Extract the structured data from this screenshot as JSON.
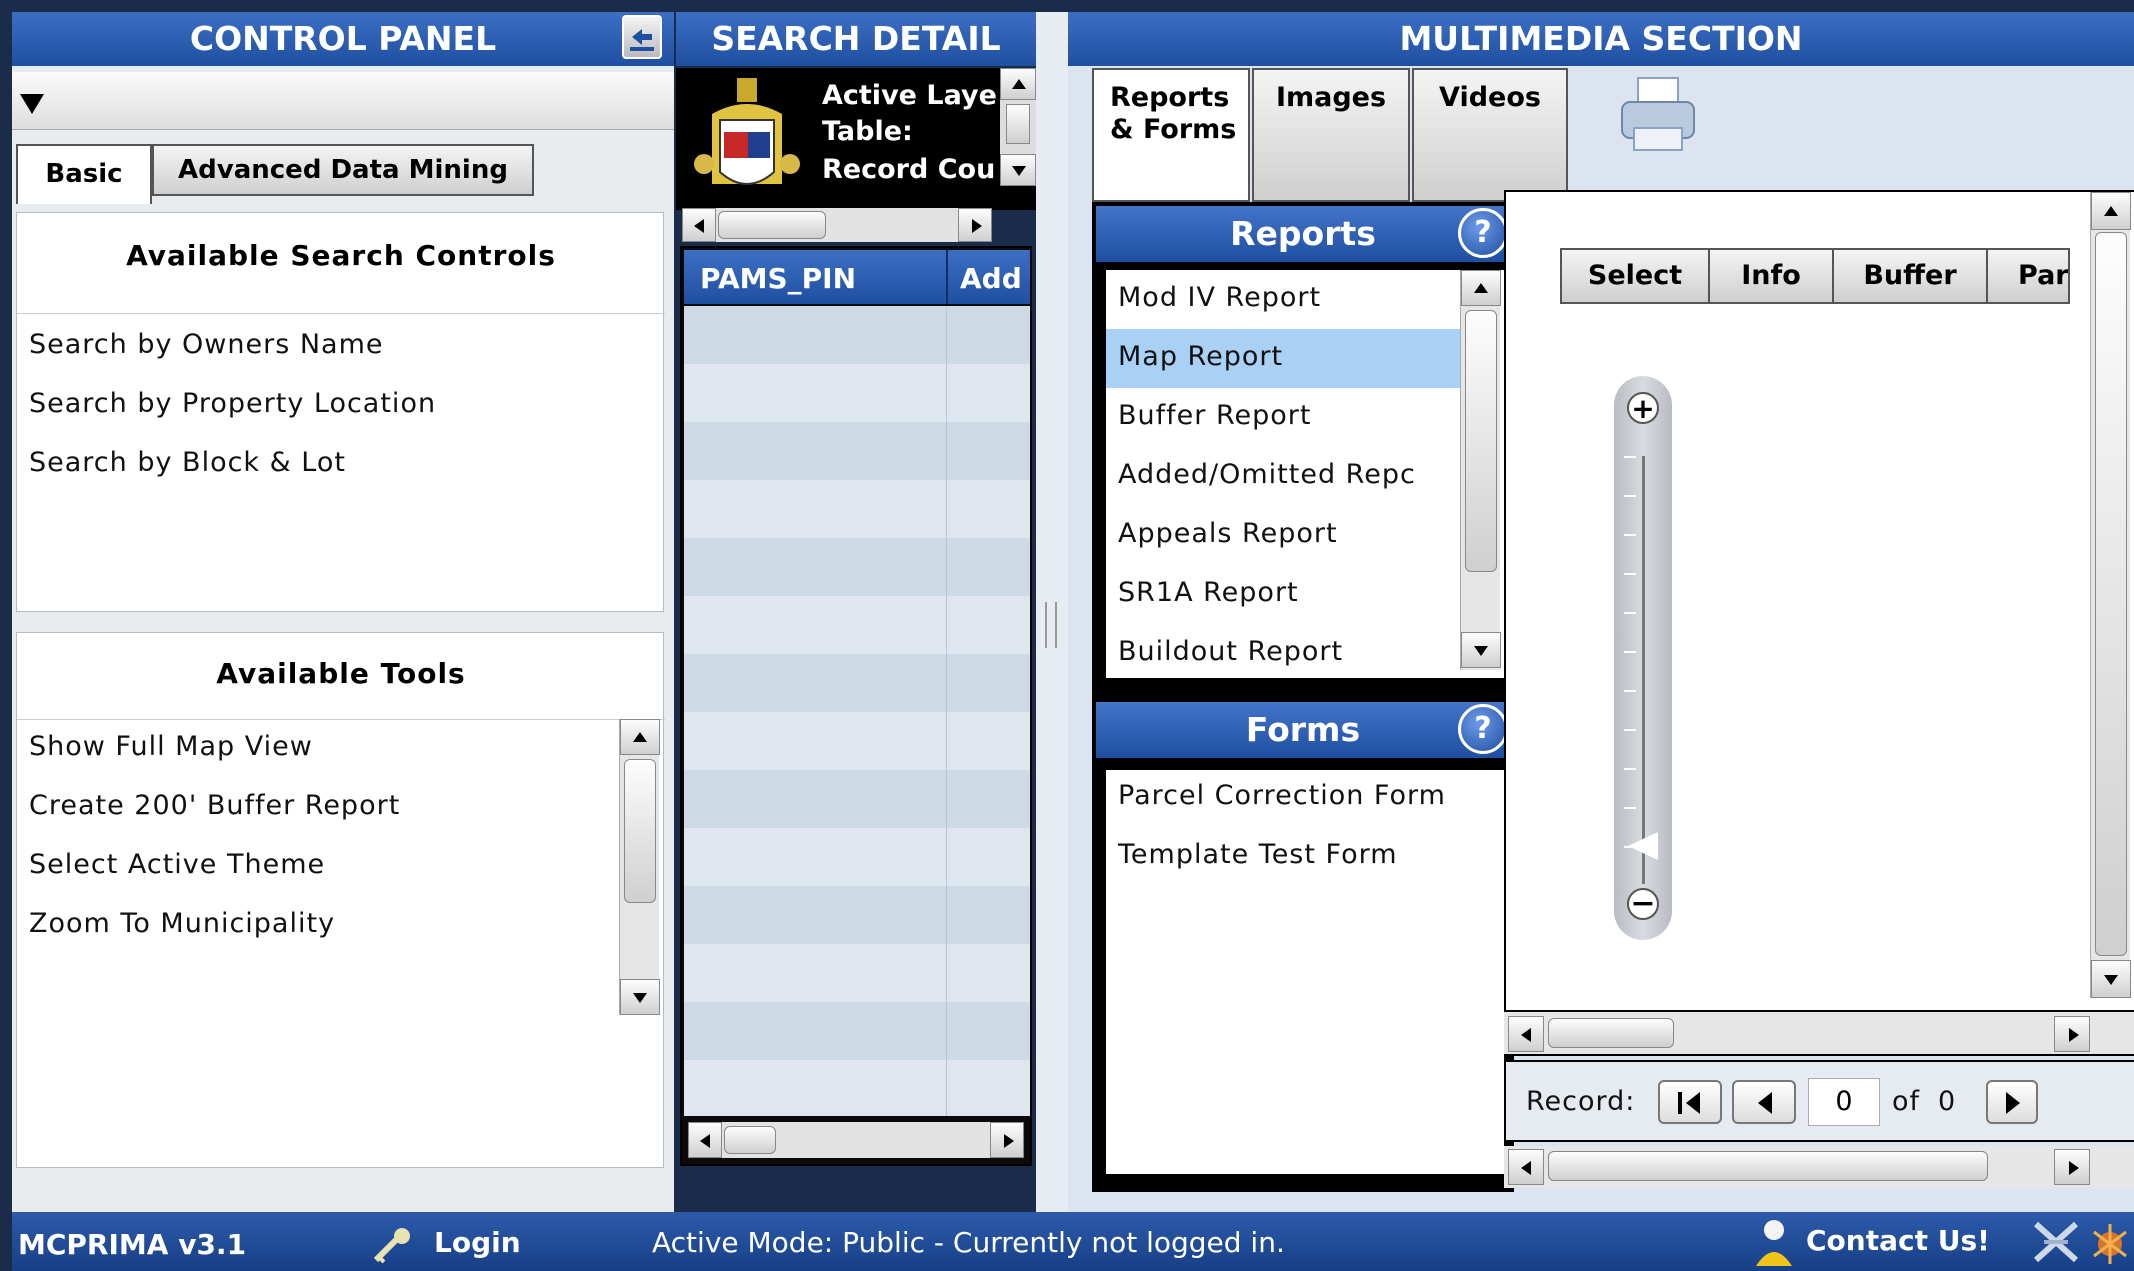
{
  "control_panel": {
    "title": "CONTROL PANEL",
    "tabs": [
      "Basic",
      "Advanced Data Mining"
    ],
    "search_heading": "Available Search Controls",
    "search_items": [
      "Search by Owners Name",
      "Search by Property Location",
      "Search by Block & Lot"
    ],
    "tools_heading": "Available Tools",
    "tool_items": [
      "Show Full Map View",
      "Create 200' Buffer Report",
      "Select Active Theme",
      "Zoom To Municipality"
    ]
  },
  "search_detail": {
    "title": "SEARCH DETAIL",
    "info_lines": [
      "Active Laye",
      "Table:",
      "Record Cou"
    ],
    "columns": [
      "PAMS_PIN",
      "Add"
    ]
  },
  "multimedia": {
    "title": "MULTIMEDIA SECTION",
    "tabs": [
      "Reports & Forms",
      "Images",
      "Videos"
    ],
    "reports_title": "Reports",
    "reports": [
      "Mod IV Report",
      "Map Report",
      "Buffer Report",
      "Added/Omitted Repc",
      "Appeals Report",
      "SR1A Report",
      "Buildout Report"
    ],
    "selected_report": "Map Report",
    "forms_title": "Forms",
    "forms": [
      "Parcel Correction Form",
      "Template Test Form"
    ],
    "help_glyph": "?",
    "map_tabs": [
      "Select",
      "Info",
      "Buffer",
      "Par"
    ],
    "record_label": "Record:",
    "record_value": "0",
    "record_of": "of",
    "record_total": "0"
  },
  "status_bar": {
    "app": "MCPRIMA v3.1",
    "login": "Login",
    "mode": "Active Mode: Public - Currently not logged in.",
    "contact": "Contact Us!"
  },
  "colors": {
    "header_blue": "#2a5bb0",
    "selected_row": "#a9d0f5",
    "background": "#1b2b4a"
  }
}
